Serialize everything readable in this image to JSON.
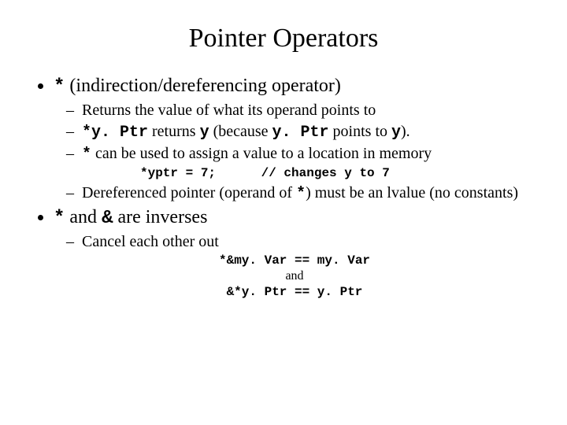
{
  "title": "Pointer Operators",
  "b1": {
    "prefix_code": "*",
    "text": " (indirection/dereferencing operator)",
    "s1": "Returns the value of what its operand points to",
    "s2": {
      "c1": "*y. Ptr",
      "t1": " returns ",
      "c2": "y",
      "t2": " (because ",
      "c3": "y. Ptr",
      "t3": " points to ",
      "c4": "y",
      "t4": ")."
    },
    "s3": {
      "c1": "*",
      "t1": " can be used to assign a value to a location in memory"
    },
    "code_line_left": "*yptr = 7;",
    "code_line_right": "// changes y to 7",
    "s4": {
      "t1": "Dereferenced pointer (operand of ",
      "c1": "*",
      "t2": ") must be an lvalue (no constants)"
    }
  },
  "b2": {
    "c1": "*",
    "t1": " and ",
    "c2": "&",
    "t2": " are inverses",
    "s1": "Cancel each other out",
    "code1": "*&my. Var == my. Var",
    "and": "and",
    "code2": "&*y. Ptr == y. Ptr"
  }
}
